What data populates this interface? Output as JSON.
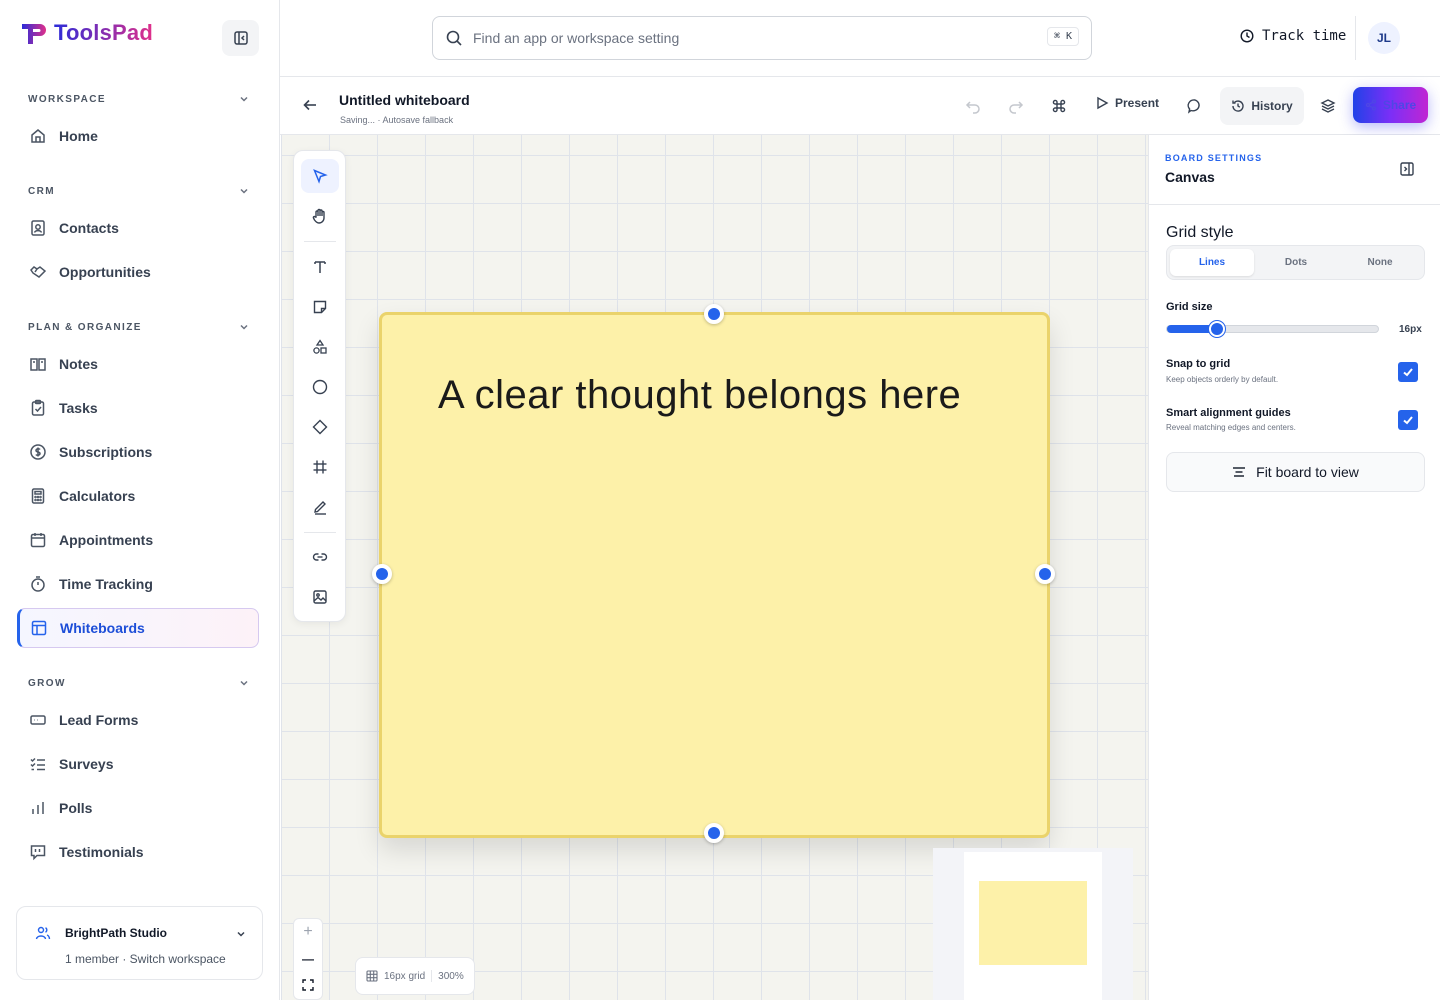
{
  "app": {
    "name": "ToolsPad",
    "brand_colors": [
      "#2b2bd8",
      "#e0308a"
    ]
  },
  "sidebar": {
    "sections": [
      {
        "title": "WORKSPACE",
        "items": [
          {
            "label": "Home",
            "icon": "home-icon"
          }
        ]
      },
      {
        "title": "CRM",
        "items": [
          {
            "label": "Contacts",
            "icon": "contacts-icon"
          },
          {
            "label": "Opportunities",
            "icon": "handshake-icon"
          }
        ]
      },
      {
        "title": "PLAN & ORGANIZE",
        "items": [
          {
            "label": "Notes",
            "icon": "notes-icon"
          },
          {
            "label": "Tasks",
            "icon": "clipboard-check-icon"
          },
          {
            "label": "Subscriptions",
            "icon": "dollar-circle-icon"
          },
          {
            "label": "Calculators",
            "icon": "calculator-icon"
          },
          {
            "label": "Appointments",
            "icon": "calendar-icon"
          },
          {
            "label": "Time Tracking",
            "icon": "stopwatch-icon"
          },
          {
            "label": "Whiteboards",
            "icon": "whiteboard-icon",
            "active": true
          }
        ]
      },
      {
        "title": "GROW",
        "items": [
          {
            "label": "Lead Forms",
            "icon": "form-icon"
          },
          {
            "label": "Surveys",
            "icon": "checklist-icon"
          },
          {
            "label": "Polls",
            "icon": "bar-chart-icon"
          },
          {
            "label": "Testimonials",
            "icon": "quote-bubble-icon"
          }
        ]
      }
    ],
    "workspace": {
      "name": "BrightPath Studio",
      "subtitle": "1 member · Switch workspace"
    }
  },
  "topbar": {
    "search_placeholder": "Find an app or workspace setting",
    "shortcut": "⌘ K",
    "track_time": "Track time",
    "avatar_initials": "JL"
  },
  "board": {
    "title": "Untitled whiteboard",
    "status": "Saving... · Autosave fallback",
    "present_label": "Present",
    "history_label": "History",
    "share_label": "Share",
    "accent": "#2563eb"
  },
  "canvas": {
    "note_text": "A clear thought belongs here",
    "note_color": "#fdf1a9",
    "grid_info": "16px grid",
    "zoom": "300%",
    "zoom_in": "+",
    "zoom_out": "—"
  },
  "panel": {
    "eyebrow": "BOARD SETTINGS",
    "title": "Canvas",
    "grid_style_label": "Grid style",
    "grid_style_options": [
      "Lines",
      "Dots",
      "None"
    ],
    "grid_style_selected": "Lines",
    "grid_size_label": "Grid size",
    "grid_size_value": "16px",
    "grid_size_fraction": 0.22,
    "snap_label": "Snap to grid",
    "snap_sub": "Keep objects orderly by default.",
    "snap_checked": true,
    "guides_label": "Smart alignment guides",
    "guides_sub": "Reveal matching edges and centers.",
    "guides_checked": true,
    "fit_label": "Fit board to view"
  }
}
